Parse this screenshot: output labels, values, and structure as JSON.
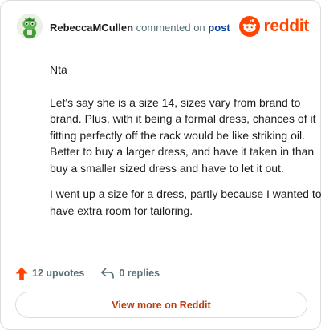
{
  "header": {
    "author": "RebeccaMCullen",
    "commented_on": "commented on",
    "post_link": "post",
    "brand": "reddit"
  },
  "comment": {
    "paragraphs": [
      "Nta",
      "Let's say she is a size 14, sizes vary from brand to brand. Plus, with it being a formal dress, chances of it fitting perfectly off the rack would be like striking oil. Better to buy a larger dress, and have it taken in than buy a smaller sized dress and have to let it out.",
      "I went up a size for a dress, partly because I wanted to have extra room for tailoring."
    ]
  },
  "actions": {
    "upvotes": "12 upvotes",
    "replies": "0 replies"
  },
  "footer": {
    "view_more": "View more on Reddit"
  },
  "colors": {
    "brand": "#ff4500",
    "link": "#0a449b",
    "muted": "#576f76",
    "view_more": "#c03a0e"
  },
  "icons": {
    "avatar": "snoo-avatar-icon",
    "logo": "reddit-snoo-icon",
    "upvote": "upvote-arrow-icon",
    "reply": "reply-arrow-icon"
  }
}
